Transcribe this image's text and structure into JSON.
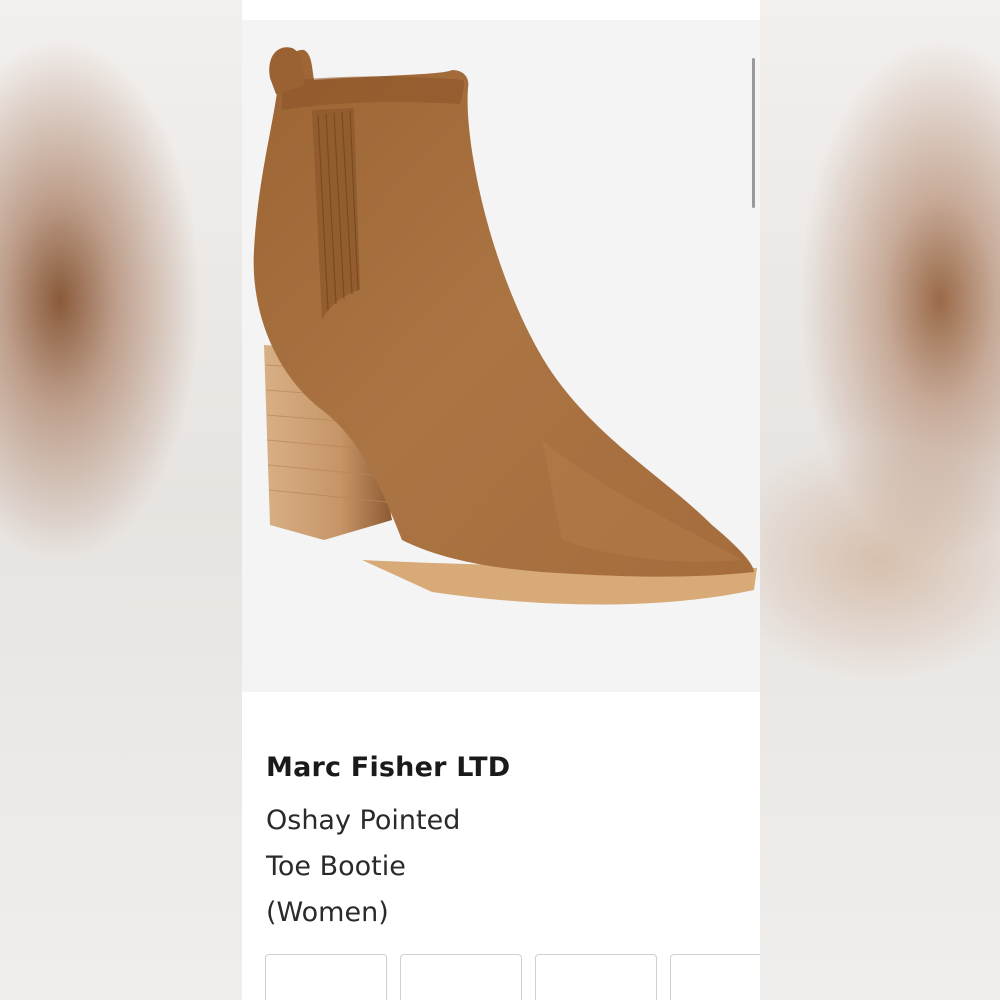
{
  "product": {
    "brand": "Marc Fisher LTD",
    "name_lines": [
      "Oshay Pointed",
      "Toe Bootie",
      "(Women)"
    ],
    "image_icon": "ankle-boot-image"
  },
  "colors": {
    "suede": "#a8703f",
    "heel": "#c99a6a",
    "background": "#ffffff"
  },
  "thumbnails_count": 4
}
